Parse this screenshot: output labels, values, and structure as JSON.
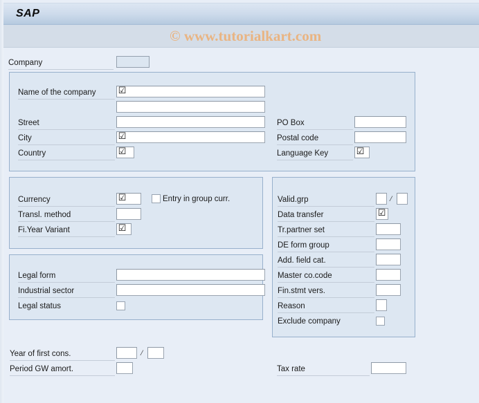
{
  "window": {
    "title": "SAP",
    "watermark": "© www.tutorialkart.com"
  },
  "colors": {
    "page_background": "#e8eef7",
    "panel_background": "#dde7f2",
    "panel_border": "#97b0cc",
    "titlebar_top": "#dce6f2",
    "titlebar_bottom": "#9fb7d1",
    "watermark_bar": "#d4dde8",
    "watermark_text": "#e9b482",
    "input_background": "#ffffff",
    "input_disabled_background": "#dce6f1",
    "input_border": "#9aa4b0",
    "label_rule": "#c3ccd8",
    "text": "#1a1a1a"
  },
  "icons": {
    "required_entry": "☑",
    "separator_slash": "/"
  },
  "header_field": {
    "label": "Company",
    "value": "",
    "placeholder": ""
  },
  "panels": {
    "address": {
      "fields": [
        {
          "label": "Name of the company",
          "value": "",
          "required": true
        },
        {
          "label": "",
          "value": "",
          "required": false
        },
        {
          "label": "Street",
          "value": "",
          "required": false
        },
        {
          "label": "City",
          "value": "",
          "required": true
        },
        {
          "label": "Country",
          "value": "",
          "required": true
        },
        {
          "label": "PO Box",
          "value": "",
          "required": false
        },
        {
          "label": "Postal code",
          "value": "",
          "required": false
        },
        {
          "label": "Language Key",
          "value": "",
          "required": true
        }
      ]
    },
    "currency": {
      "fields": [
        {
          "label": "Currency",
          "value": "",
          "required": true
        },
        {
          "label": "Transl. method",
          "value": "",
          "required": false
        },
        {
          "label": "Fi.Year Variant",
          "value": "",
          "required": true
        }
      ],
      "checkbox": {
        "label": "Entry in group curr.",
        "checked": false
      }
    },
    "legal": {
      "fields": [
        {
          "label": "Legal form",
          "value": "",
          "required": false
        },
        {
          "label": "Industrial sector",
          "value": "",
          "required": false
        }
      ],
      "checkbox": {
        "label": "Legal status",
        "checked": false
      }
    },
    "consolidation": {
      "fields": [
        {
          "label": "Valid.grp",
          "value": "",
          "value2": "",
          "required": false
        },
        {
          "label": "Data transfer",
          "value": "",
          "required": true
        },
        {
          "label": "Tr.partner set",
          "value": "",
          "required": false
        },
        {
          "label": "DE form group",
          "value": "",
          "required": false
        },
        {
          "label": "Add. field cat.",
          "value": "",
          "required": false
        },
        {
          "label": "Master co.code",
          "value": "",
          "required": false
        },
        {
          "label": "Fin.stmt vers.",
          "value": "",
          "required": false
        },
        {
          "label": "Reason",
          "value": "",
          "required": false
        }
      ],
      "checkbox": {
        "label": "Exclude company",
        "checked": false
      }
    }
  },
  "footer": {
    "fields": [
      {
        "label": "Year of first cons.",
        "value": "",
        "value2": ""
      },
      {
        "label": "Period GW amort.",
        "value": ""
      },
      {
        "label": "Tax rate",
        "value": ""
      }
    ]
  }
}
